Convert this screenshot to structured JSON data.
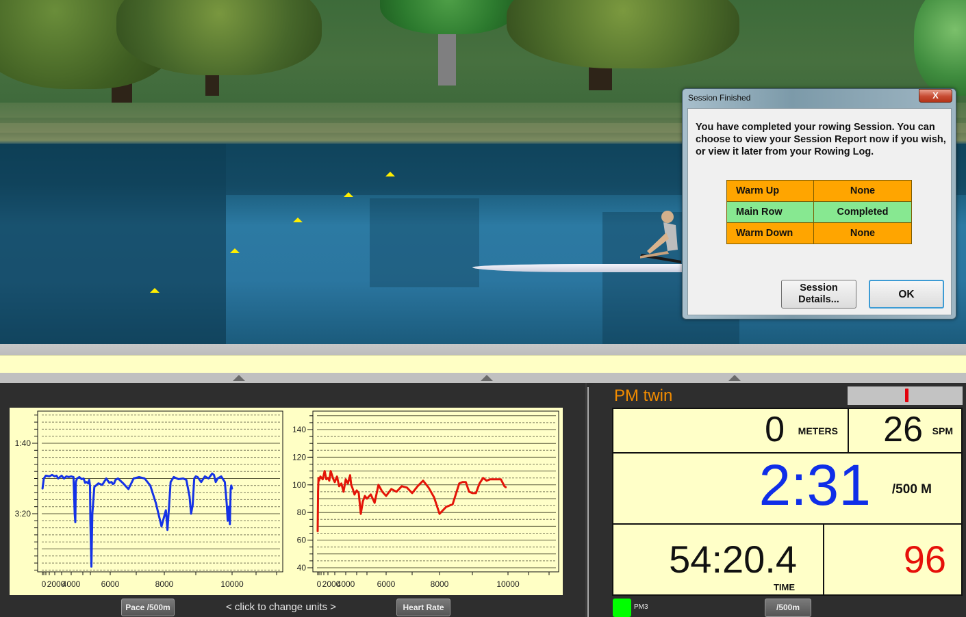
{
  "scene": {
    "name": "rowing-course-3d-view",
    "buoy_color": "#ffee00"
  },
  "dialog": {
    "title": "Session Finished",
    "close_label": "X",
    "message": "You have completed your rowing Session.  You can choose to view your Session Report now if you wish, or view it later from your Rowing Log.",
    "phases": [
      {
        "label": "Warm Up",
        "status": "None",
        "color": "#ffa500"
      },
      {
        "label": "Main Row",
        "status": "Completed",
        "color": "#87e891"
      },
      {
        "label": "Warm Down",
        "status": "None",
        "color": "#ffa500"
      }
    ],
    "details_button": "Session Details...",
    "ok_button": "OK"
  },
  "charts": {
    "units_hint": "<  click to change units  >",
    "pace_button": "Pace /500m",
    "hr_button": "Heart Rate"
  },
  "chart_data": [
    {
      "type": "line",
      "title": "Pace /500m",
      "xlabel": "",
      "ylabel": "",
      "color": "#1432e6",
      "y_inverted": true,
      "ylim_seconds": [
        53,
        282
      ],
      "ytick_labels": [
        {
          "value": 100,
          "label": "1:40"
        },
        {
          "value": 200,
          "label": "3:20"
        }
      ],
      "x_tick_labels": [
        "0",
        "2000",
        "4000",
        "6000",
        "8000",
        "10000"
      ],
      "grid": true,
      "x": [
        0,
        100,
        250,
        500,
        750,
        1000,
        1250,
        1500,
        1750,
        2000,
        2250,
        2500,
        2750,
        3000,
        3200,
        3300,
        3350,
        3400,
        3500,
        3700,
        3900,
        4100,
        4300,
        4500,
        4700,
        4850,
        4950,
        5000,
        5050,
        5100,
        5200,
        5400,
        5600,
        5800,
        5950,
        6050,
        6100,
        6150,
        6200,
        6300,
        6500,
        6700,
        6900,
        7100,
        7300,
        7500,
        7700,
        7900,
        8050,
        8100,
        8150,
        8200,
        8300,
        8450,
        8600,
        8700,
        8800,
        8850,
        8900,
        8950,
        9000,
        9050,
        9150,
        9250,
        9350,
        9450,
        9500,
        9550,
        9600,
        9700,
        9800,
        9850,
        9880,
        9910,
        9940,
        9960,
        9980,
        10000
      ],
      "values": [
        165,
        150,
        146,
        147,
        145,
        147,
        146,
        150,
        148,
        146,
        150,
        147,
        148,
        147,
        148,
        200,
        212,
        155,
        150,
        148,
        151,
        150,
        156,
        155,
        157,
        152,
        160,
        210,
        275,
        200,
        162,
        157,
        159,
        150,
        156,
        155,
        158,
        157,
        152,
        150,
        157,
        165,
        150,
        148,
        150,
        160,
        185,
        218,
        195,
        223,
        190,
        155,
        148,
        151,
        150,
        152,
        175,
        200,
        188,
        150,
        147,
        148,
        155,
        147,
        150,
        143,
        145,
        155,
        150,
        147,
        155,
        185,
        210,
        190,
        215,
        165,
        160,
        165
      ]
    },
    {
      "type": "line",
      "title": "Heart Rate",
      "xlabel": "",
      "ylabel": "",
      "color": "#e31408",
      "ylim": [
        37,
        152
      ],
      "ytick_labels": [
        40,
        60,
        80,
        100,
        120,
        140
      ],
      "x_tick_labels": [
        "0",
        "2000",
        "4000",
        "6000",
        "8000",
        "10000"
      ],
      "grid": true,
      "x": [
        0,
        30,
        60,
        100,
        200,
        400,
        600,
        800,
        1000,
        1200,
        1400,
        1600,
        1800,
        2000,
        2200,
        2400,
        2600,
        2800,
        3000,
        3200,
        3400,
        3500,
        3600,
        3800,
        4000,
        4200,
        4400,
        4600,
        4800,
        5000,
        5200,
        5400,
        5600,
        5800,
        6000,
        6200,
        6400,
        6600,
        6800,
        7000,
        7200,
        7400,
        7600,
        7800,
        8000,
        8200,
        8400,
        8600,
        8700,
        8800,
        8900,
        9000,
        9100,
        9200,
        9300,
        9400,
        9500,
        9600,
        9700,
        9800,
        9900,
        9950
      ],
      "values": [
        66,
        95,
        105,
        103,
        106,
        104,
        110,
        104,
        105,
        103,
        110,
        107,
        104,
        102,
        106,
        99,
        101,
        95,
        104,
        101,
        107,
        100,
        98,
        93,
        96,
        94,
        79,
        88,
        92,
        90,
        93,
        87,
        100,
        95,
        92,
        97,
        95,
        99,
        98,
        94,
        99,
        103,
        98,
        91,
        79,
        84,
        86,
        101,
        102,
        102,
        95,
        94,
        94,
        101,
        105,
        103,
        104,
        104,
        104,
        104,
        99,
        98
      ]
    }
  ],
  "monitor": {
    "title": "PM twin",
    "meters_value": "0",
    "meters_unit": "METERS",
    "spm_value": "26",
    "spm_unit": "SPM",
    "pace_value": "2:31",
    "pace_unit": "/500 M",
    "time_value": "54:20.4",
    "time_unit": "TIME",
    "hr_value": "96",
    "pace_color": "#0f2ee8",
    "hr_color": "#e6100a",
    "device_label": "PM3",
    "device_status_color": "#00ff00",
    "units_button": "/500m"
  }
}
